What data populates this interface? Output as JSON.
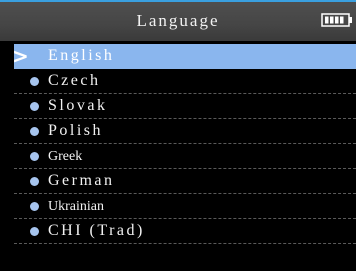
{
  "header": {
    "title": "Language",
    "battery_icon": "battery-icon"
  },
  "languages": [
    {
      "label": "English",
      "selected": true
    },
    {
      "label": "Czech",
      "selected": false
    },
    {
      "label": "Slovak",
      "selected": false
    },
    {
      "label": "Polish",
      "selected": false
    },
    {
      "label": "Greek",
      "selected": false
    },
    {
      "label": "German",
      "selected": false
    },
    {
      "label": "Ukrainian",
      "selected": false
    },
    {
      "label": "CHI (Trad)",
      "selected": false
    }
  ],
  "colors": {
    "highlight": "#8ab6ee",
    "bullet": "#a6c4ee",
    "header_accent": "#3aa0e0"
  }
}
